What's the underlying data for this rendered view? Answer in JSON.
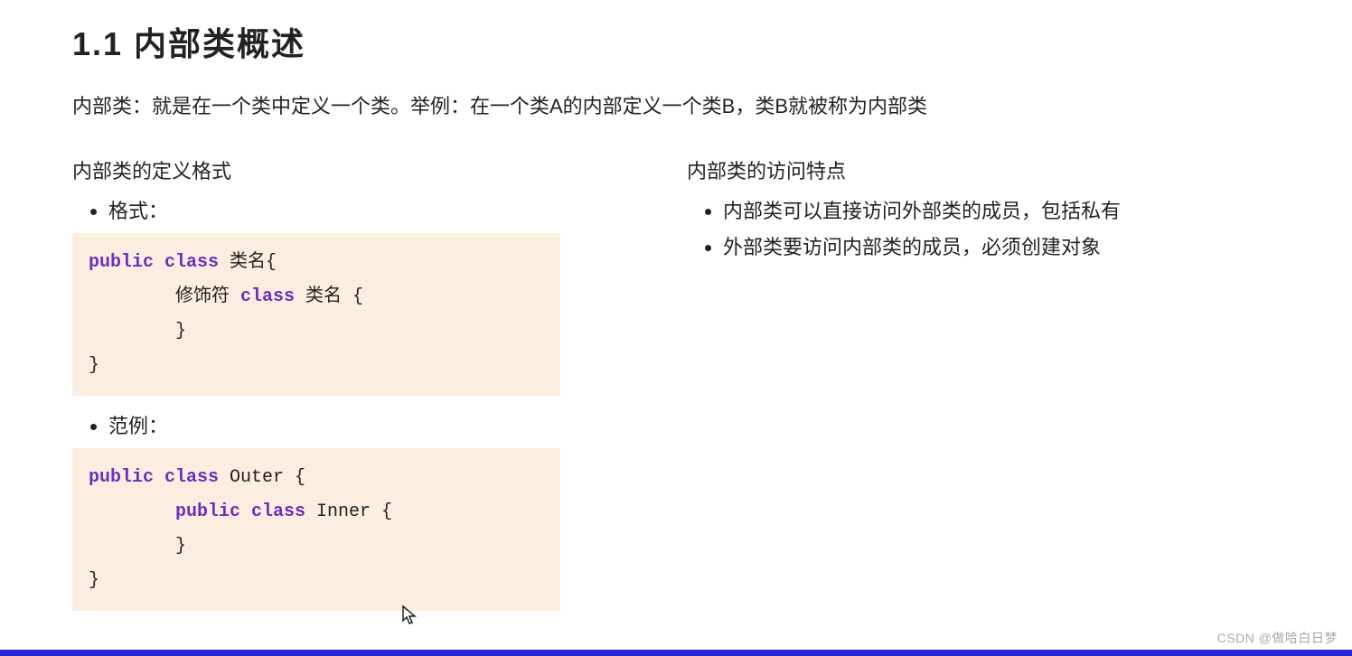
{
  "heading": "1.1 内部类概述",
  "intro": "内部类：就是在一个类中定义一个类。举例：在一个类A的内部定义一个类B，类B就被称为内部类",
  "left": {
    "subhead": "内部类的定义格式",
    "item_format": "格式：",
    "item_example": "范例：",
    "code1": {
      "l1_pre": "public class ",
      "l1_post": "类名{",
      "l2_pre": "        修饰符 ",
      "l2_kw": "class ",
      "l2_post": "类名 {",
      "l3": "        }",
      "l4": "}"
    },
    "code2": {
      "l1_pre": "public class ",
      "l1_post": "Outer {",
      "l2_pre": "        ",
      "l2_kw": "public class ",
      "l2_post": "Inner {",
      "l3": "        }",
      "l4": "}"
    }
  },
  "right": {
    "subhead": "内部类的访问特点",
    "points": [
      "内部类可以直接访问外部类的成员，包括私有",
      "外部类要访问内部类的成员，必须创建对象"
    ]
  },
  "watermark": "CSDN @做哈白日梦"
}
